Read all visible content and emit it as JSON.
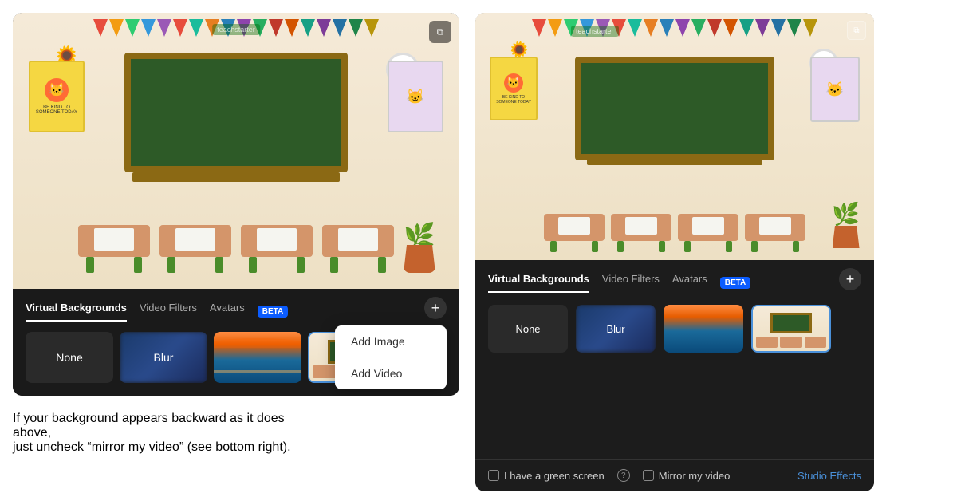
{
  "left_panel": {
    "tabs": [
      {
        "label": "Virtual Backgrounds",
        "active": true
      },
      {
        "label": "Video Filters",
        "active": false
      },
      {
        "label": "Avatars",
        "active": false
      }
    ],
    "beta_label": "BETA",
    "thumbnails": [
      {
        "label": "None",
        "type": "none"
      },
      {
        "label": "Blur",
        "type": "blur"
      },
      {
        "label": "",
        "type": "bridge"
      },
      {
        "label": "",
        "type": "classroom-selected"
      }
    ],
    "dropdown": {
      "items": [
        {
          "label": "Add Image"
        },
        {
          "label": "Add Video"
        }
      ]
    }
  },
  "right_panel": {
    "tabs": [
      {
        "label": "Virtual Backgrounds",
        "active": true
      },
      {
        "label": "Video Filters",
        "active": false
      },
      {
        "label": "Avatars",
        "active": false
      }
    ],
    "beta_label": "BETA",
    "thumbnails": [
      {
        "label": "None",
        "type": "none"
      },
      {
        "label": "Blur",
        "type": "blur"
      },
      {
        "label": "",
        "type": "bridge"
      },
      {
        "label": "",
        "type": "classroom-selected"
      }
    ],
    "footer": {
      "green_screen_label": "I have a green screen",
      "mirror_label": "Mirror my video",
      "studio_effects_label": "Studio Effects"
    }
  },
  "caption": {
    "line1": "If your background appears backward as it does above,",
    "line2": "just uncheck “mirror my video” (see bottom right)."
  },
  "logo": "teachstarter",
  "icons": {
    "add": "+",
    "copy": "⧉",
    "info": "?"
  }
}
